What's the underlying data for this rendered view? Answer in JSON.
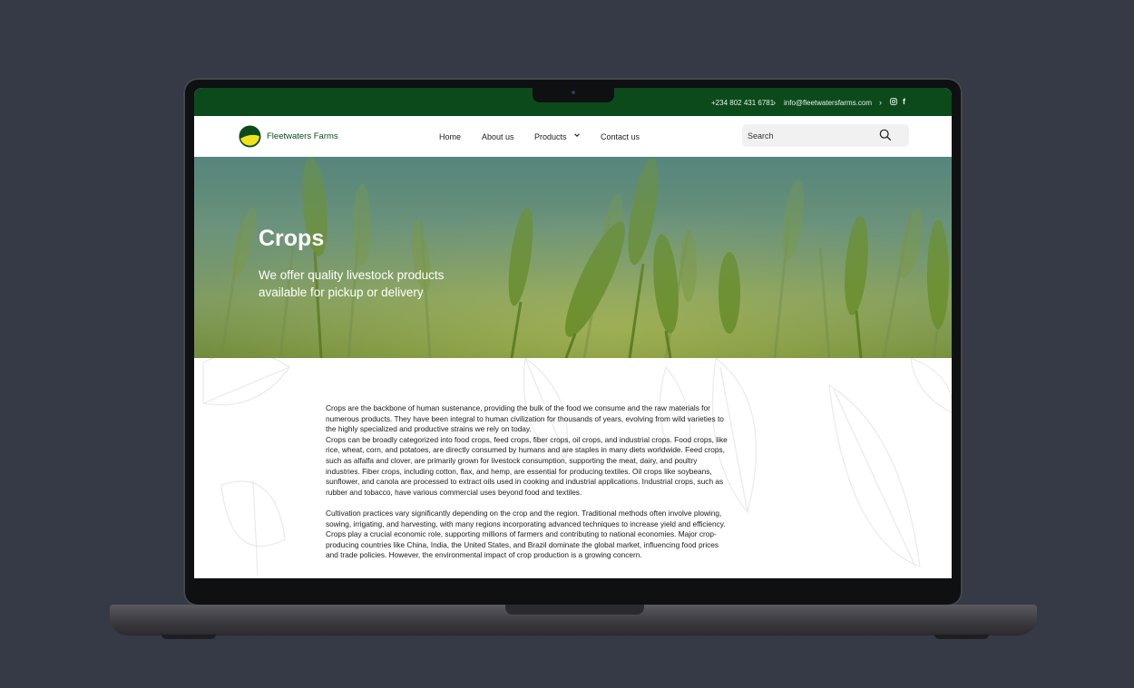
{
  "topbar": {
    "phone": "+234 802 431 6781",
    "email": "info@fleetwatersfarms.com"
  },
  "brand": {
    "name": "Fleetwaters Farms",
    "colors": {
      "primary": "#0c4a1c",
      "accent": "#f2e21a"
    }
  },
  "nav": {
    "home": "Home",
    "about": "About us",
    "products": "Products",
    "contact": "Contact us"
  },
  "search": {
    "placeholder": "Search"
  },
  "hero": {
    "title": "Crops",
    "subtitle": "We offer quality livestock products available for pickup or delivery"
  },
  "content": {
    "p1a": "Crops are the backbone of human sustenance, providing the bulk of the food we consume and the raw materials for numerous products. They have been integral to human civilization for thousands of years, evolving from wild varieties to the highly specialized and productive strains we rely on today.",
    "p1b": "Crops can be broadly categorized into food crops, feed crops, fiber crops, oil crops, and industrial crops. Food crops, like rice, wheat, corn, and potatoes, are directly consumed by humans and are staples in many diets worldwide. Feed crops, such as alfalfa and clover, are primarily grown for livestock consumption, supporting the meat, dairy, and poultry industries. Fiber crops, including cotton, flax, and hemp, are essential for producing textiles. Oil crops like soybeans, sunflower, and canola are processed to extract oils used in cooking and industrial applications. Industrial crops, such as rubber and tobacco, have various commercial uses beyond food and textiles.",
    "p2a": "Cultivation practices vary significantly depending on the crop and the region. Traditional methods often involve plowing, sowing, irrigating, and harvesting, with many regions incorporating advanced techniques to increase yield and efficiency.",
    "p2b": "Crops play a crucial economic role, supporting millions of farmers and contributing to national economies. Major crop-producing countries like China, India, the United States, and Brazil dominate the global market, influencing food prices and trade policies. However, the environmental impact of crop production is a growing concern."
  }
}
